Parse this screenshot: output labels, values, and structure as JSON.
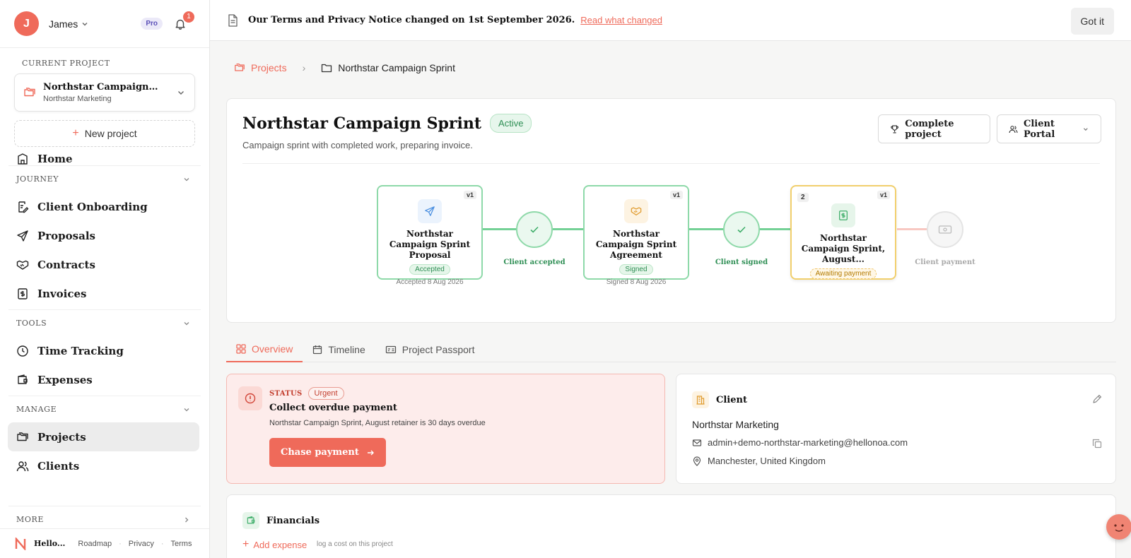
{
  "user": {
    "initial": "J",
    "name": "James",
    "plan": "Pro",
    "notifications": "1"
  },
  "sidebar": {
    "current_project_label": "CURRENT PROJECT",
    "current_project": {
      "name": "Northstar Campaign Sprint",
      "client": "Northstar Marketing"
    },
    "new_project": "New project",
    "home": "Home",
    "sections": {
      "journey": "JOURNEY",
      "tools": "TOOLS",
      "manage": "MANAGE",
      "more": "MORE"
    },
    "journey_items": [
      "Client Onboarding",
      "Proposals",
      "Contracts",
      "Invoices"
    ],
    "tools_items": [
      "Time Tracking",
      "Expenses"
    ],
    "manage_items": [
      "Projects",
      "Clients"
    ],
    "footer": {
      "brand": "Hello...",
      "roadmap": "Roadmap",
      "privacy": "Privacy",
      "terms": "Terms"
    }
  },
  "banner": {
    "text": "Our Terms and Privacy Notice changed on 1st September 2026.",
    "link": "Read what changed",
    "dismiss": "Got it"
  },
  "breadcrumb": {
    "root": "Projects",
    "current": "Northstar Campaign Sprint"
  },
  "project": {
    "title": "Northstar Campaign Sprint",
    "status": "Active",
    "description": "Campaign sprint with completed work, preparing invoice.",
    "complete_button": "Complete project",
    "portal_button": "Client Portal"
  },
  "flow": {
    "nodes": [
      {
        "version": "v1",
        "title": "Northstar Campaign Sprint Proposal",
        "status": "Accepted",
        "date": "Accepted 8 Aug 2026"
      },
      {
        "version": "v1",
        "title": "Northstar Campaign Sprint Agreement",
        "status": "Signed",
        "date": "Signed 8 Aug 2026"
      },
      {
        "version": "v1",
        "count": "2",
        "title": "Northstar Campaign Sprint, August...",
        "status": "Awaiting payment"
      }
    ],
    "steps": [
      "Client accepted",
      "Client signed",
      "Client payment"
    ]
  },
  "tabs": [
    "Overview",
    "Timeline",
    "Project Passport"
  ],
  "status_card": {
    "label": "STATUS",
    "urgency": "Urgent",
    "title": "Collect overdue payment",
    "description": "Northstar Campaign Sprint, August retainer is 30 days overdue",
    "action": "Chase payment"
  },
  "client": {
    "heading": "Client",
    "name": "Northstar Marketing",
    "email": "admin+demo-northstar-marketing@hellonoa.com",
    "location": "Manchester, United Kingdom"
  },
  "financials": {
    "heading": "Financials",
    "add_expense": "Add expense",
    "add_hint": "log a cost on this project"
  },
  "colors": {
    "accent": "#ef6a5a",
    "success": "#2f8f55",
    "warning": "#f1cf6c"
  }
}
